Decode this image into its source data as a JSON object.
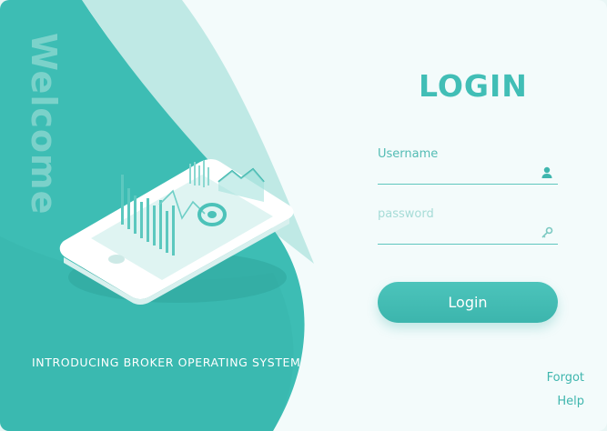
{
  "left_panel": {
    "welcome_text": "Welcome",
    "tagline": "INTRODUCING BROKER OPERATING SYSTEM",
    "illustration": "phone-with-charts-illustration"
  },
  "form": {
    "title": "LOGIN",
    "username": {
      "label": "Username",
      "value": "",
      "icon": "user-icon"
    },
    "password": {
      "label": "password",
      "value": "",
      "icon": "key-icon"
    },
    "login_button": "Login"
  },
  "links": {
    "forgot": "Forgot",
    "help": "Help"
  },
  "colors": {
    "primary": "#3cb5ad",
    "light": "#c6ebe8",
    "background": "#f3fbfb"
  }
}
